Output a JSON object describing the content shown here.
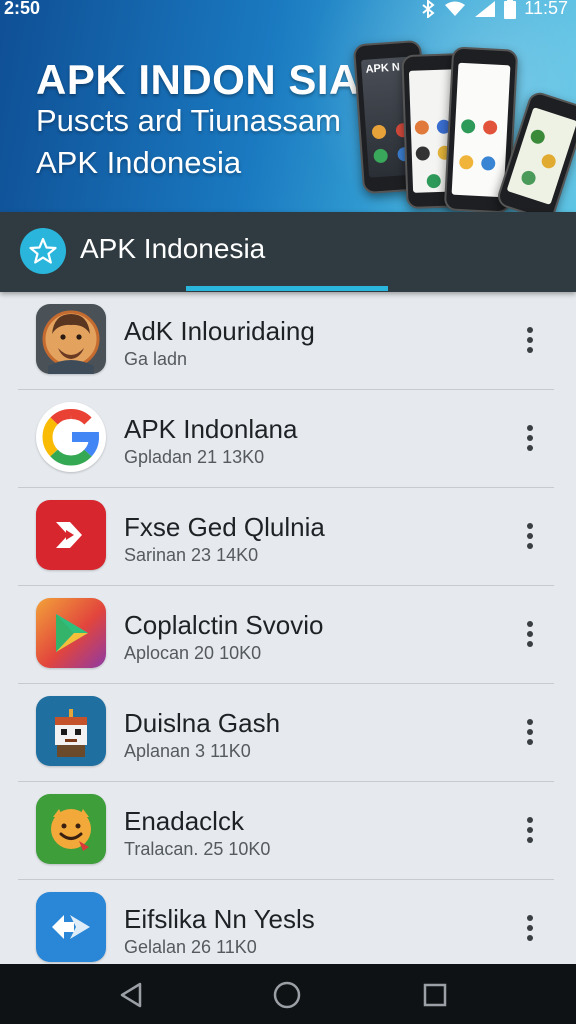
{
  "status_bar": {
    "left_time": "2:50",
    "right_time": "11:57",
    "icons": [
      "bluetooth-icon",
      "wifi-icon",
      "signal-icon",
      "battery-icon"
    ]
  },
  "banner": {
    "title": "APK INDON SIA",
    "subtitle_1": "Puscts ard Tiunassam",
    "subtitle_2": "APK Indonesia",
    "phone_label": "APK N"
  },
  "toolbar": {
    "icon": "star-icon",
    "title": "APK Indonesia"
  },
  "apps": [
    {
      "name": "AdK Inlouridaing",
      "meta": "Ga ladn",
      "icon": "avatar-icon"
    },
    {
      "name": "APK Indonlana",
      "meta": "Gpladan 21 13K0",
      "icon": "google-g-icon"
    },
    {
      "name": "Fxse Ged Qlulnia",
      "meta": "Sarinan 23 14K0",
      "icon": "red-arrow-icon"
    },
    {
      "name": "Coplalctin Svovio",
      "meta": "Aplocan 20 10K0",
      "icon": "play-triangle-icon"
    },
    {
      "name": "Duislna Gash",
      "meta": "Aplanan 3 11K0",
      "icon": "pixel-character-icon"
    },
    {
      "name": "Enadaclck",
      "meta": "Tralacan. 25 10K0",
      "icon": "smiley-icon"
    },
    {
      "name": "Eifslika Nn Yesls",
      "meta": "Gelalan 26 11K0",
      "icon": "blue-arrow-icon"
    }
  ],
  "navbar": {
    "icons": [
      "back-icon",
      "home-icon",
      "recents-icon"
    ]
  },
  "colors": {
    "accent": "#2ab6dc",
    "toolbar": "#2f3b41",
    "banner_start": "#0f4f95",
    "banner_end": "#57c2e4"
  }
}
